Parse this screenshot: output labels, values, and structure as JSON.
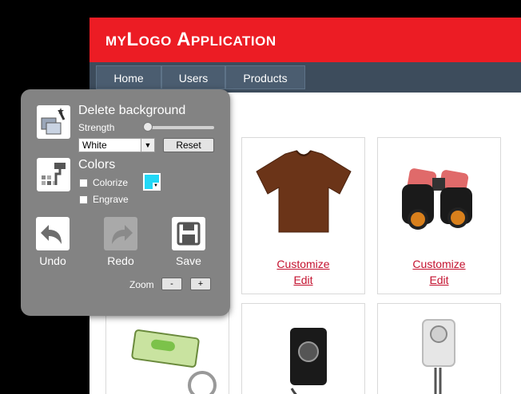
{
  "app": {
    "title": "myLogo Application"
  },
  "nav": {
    "tabs": [
      "Home",
      "Users",
      "Products"
    ]
  },
  "products": [
    {
      "customize": "Customize",
      "edit": "Edit"
    },
    {
      "customize": "Customize",
      "edit": "Edit"
    }
  ],
  "panel": {
    "delete_bg": {
      "title": "Delete background",
      "strength_label": "Strength",
      "strength_value": 0.05,
      "color_select": "White",
      "reset_label": "Reset"
    },
    "colors": {
      "title": "Colors",
      "colorize_label": "Colorize",
      "engrave_label": "Engrave",
      "swatch_color": "#22d8f6"
    },
    "actions": {
      "undo": "Undo",
      "redo": "Redo",
      "save": "Save"
    },
    "zoom": {
      "label": "Zoom",
      "minus": "-",
      "plus": "+"
    }
  },
  "colors": {
    "brand_red": "#ec1c24",
    "nav_bg": "#3d4c5c",
    "link": "#c4122f",
    "panel_bg": "#838383"
  }
}
